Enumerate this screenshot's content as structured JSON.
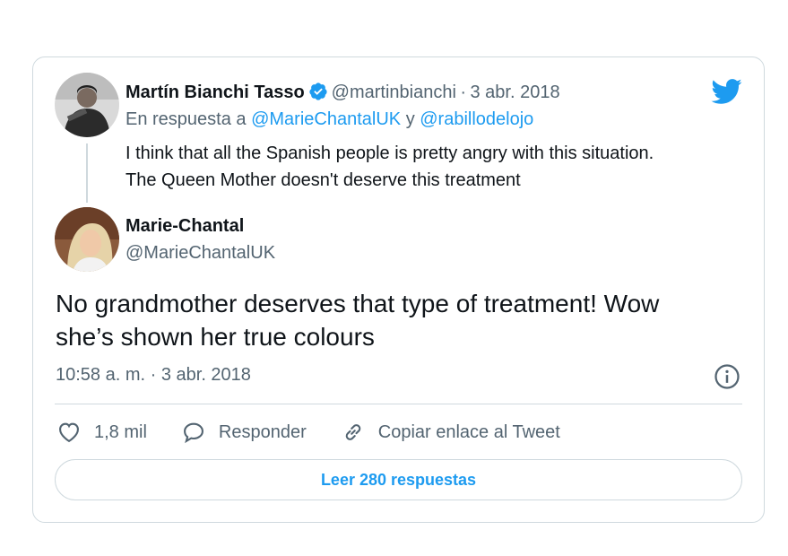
{
  "reply_tweet": {
    "author_name": "Martín Bianchi Tasso",
    "author_handle": "@martinbianchi",
    "separator": "·",
    "date": "3 abr. 2018",
    "in_reply_to_prefix": "En respuesta a",
    "reply_handle_1": "@MarieChantalUK",
    "reply_conjunction": "y",
    "reply_handle_2": "@rabillodelojo",
    "text_line_1": "I think that all the Spanish people is pretty angry with this situation.",
    "text_line_2": "The Queen Mother doesn't deserve this treatment"
  },
  "main_tweet": {
    "author_name": "Marie-Chantal",
    "author_handle": "@MarieChantalUK",
    "text_line_1": "No grandmother deserves that type of treatment! Wow",
    "text_line_2": "she’s shown her true colours",
    "timestamp": "10:58 a. m. · 3 abr. 2018"
  },
  "actions": {
    "likes_count": "1,8 mil",
    "reply_label": "Responder",
    "copy_link_label": "Copiar enlace al Tweet"
  },
  "read_replies_label": "Leer 280 respuestas",
  "colors": {
    "accent": "#1d9bf0",
    "text": "#0f1419",
    "muted": "#536471",
    "border": "#cfd9de"
  },
  "icons": [
    "twitter-bird-icon",
    "verified-badge-icon",
    "info-icon",
    "heart-icon",
    "reply-bubble-icon",
    "link-icon"
  ]
}
